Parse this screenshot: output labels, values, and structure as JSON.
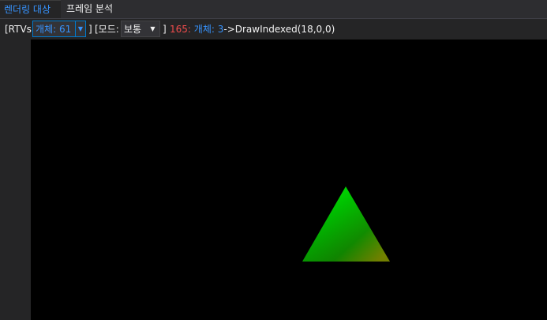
{
  "tabs": {
    "render_target": "렌더링 대상",
    "frame_analysis": "프레임 분석"
  },
  "toolbar": {
    "rtvs_label": "[RTVs:",
    "object_combo_value": "개체: 61",
    "bracket_close_1": "]",
    "mode_label": "[모드:",
    "mode_combo_value": "보통",
    "bracket_close_2": "]",
    "event_number": "165:",
    "event_object": "개체: 3",
    "event_call": "->DrawIndexed(18,0,0)"
  },
  "icons": {
    "combo_arrow_1": "dropdown-arrow-icon",
    "combo_arrow_2": "dropdown-arrow-icon"
  },
  "colors": {
    "accent": "#007acc",
    "link_blue": "#3794ff",
    "event_red": "#f14c4c",
    "triangle_green": "#00e000",
    "triangle_dark_green": "#009900",
    "triangle_olive": "#8a9a00",
    "viewport_bg": "#000000"
  }
}
